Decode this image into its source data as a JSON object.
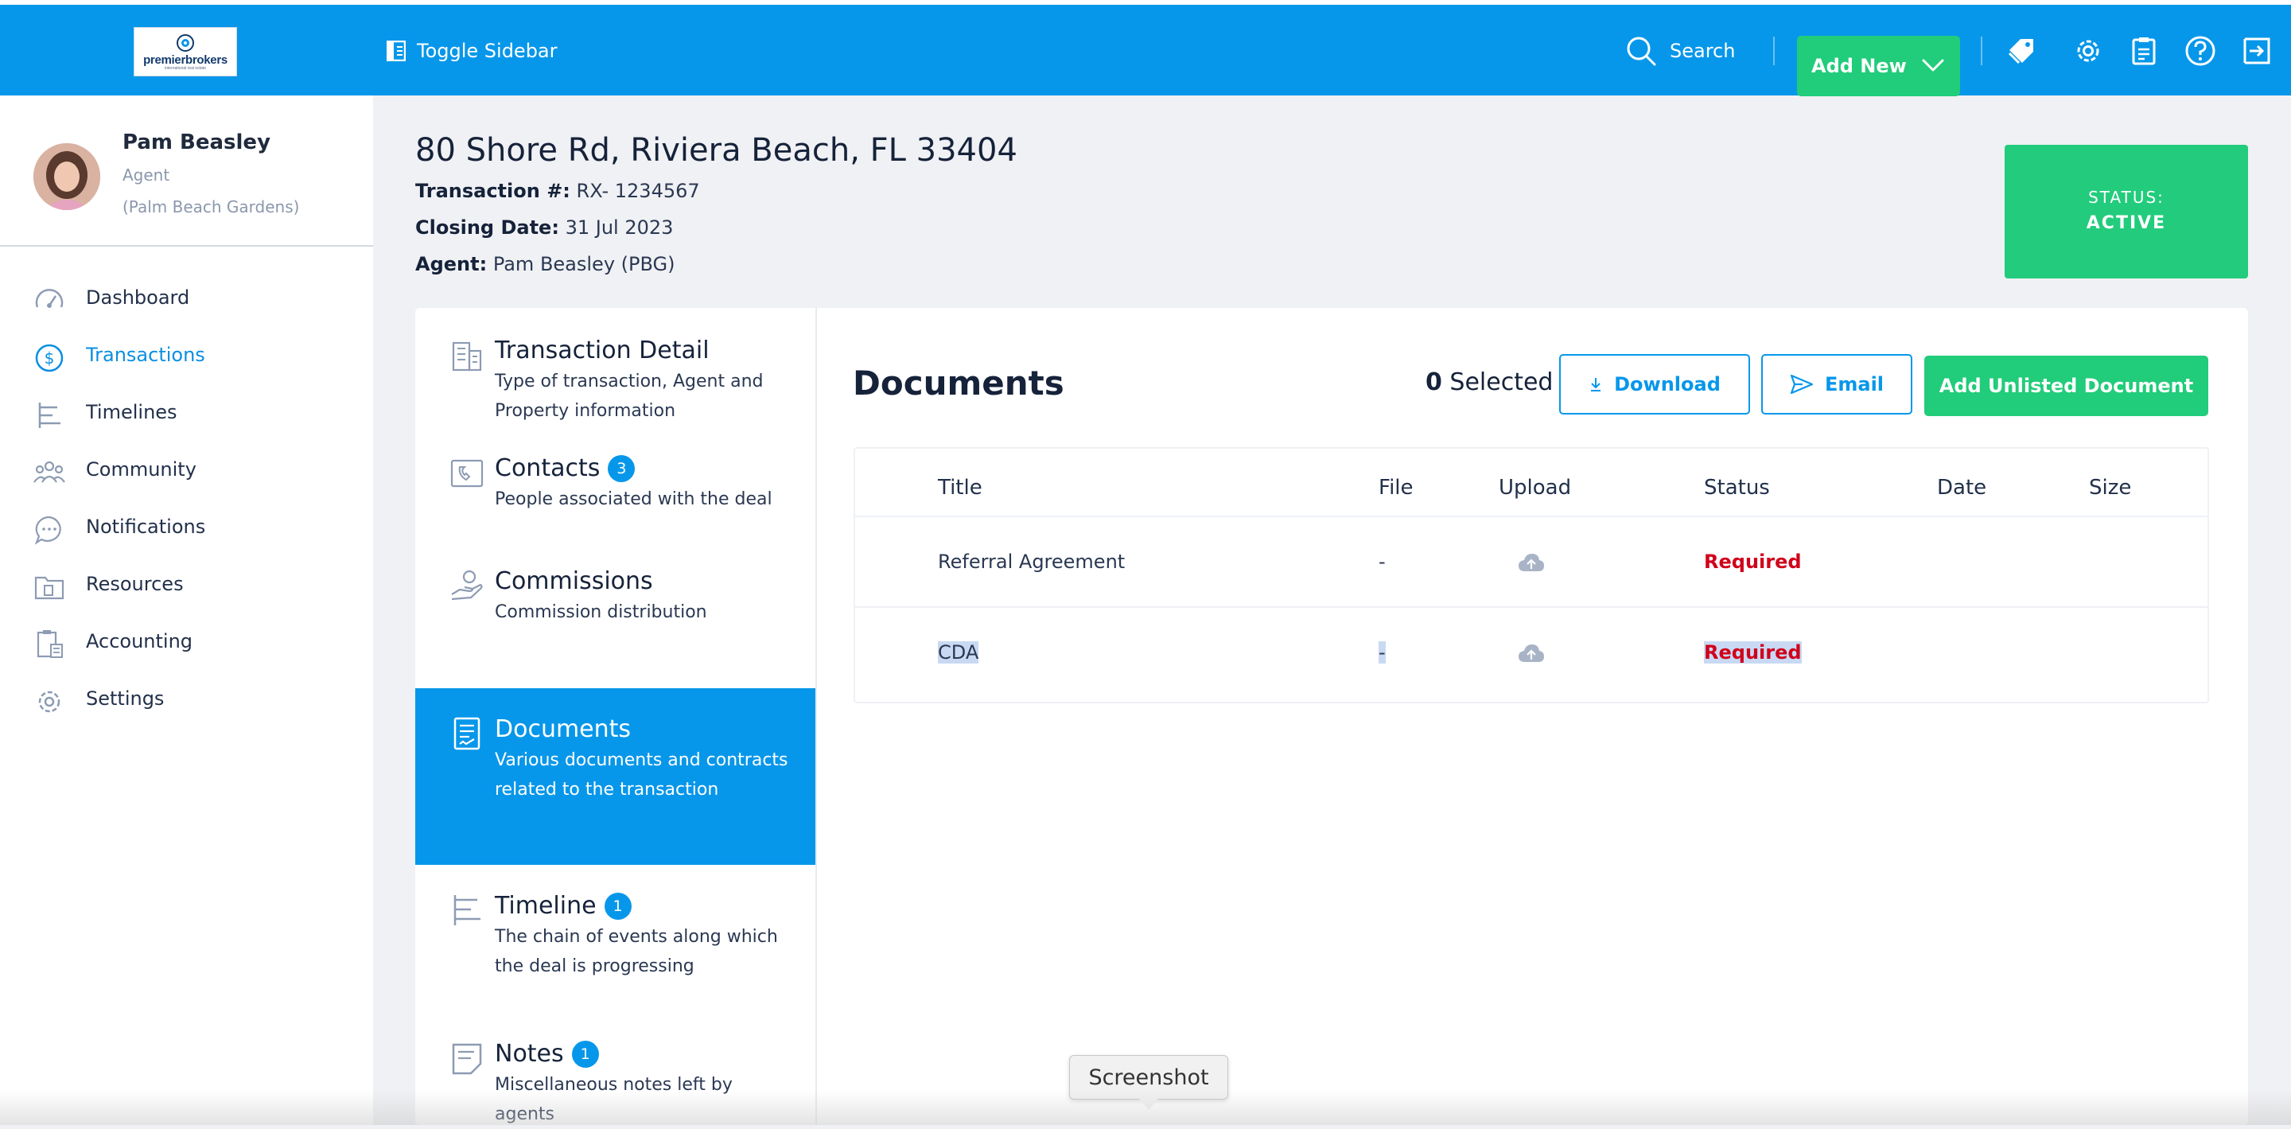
{
  "header": {
    "logo_text": "premierbrokers",
    "logo_subtext": "international real estate",
    "toggle_sidebar_label": "Toggle Sidebar",
    "search_label": "Search",
    "add_new_label": "Add New",
    "icons": [
      "tag-icon",
      "gear-icon",
      "clipboard-icon",
      "help-icon",
      "logout-icon"
    ]
  },
  "user": {
    "name": "Pam Beasley",
    "role": "Agent",
    "office": "(Palm Beach Gardens)"
  },
  "sidebar": {
    "items": [
      {
        "label": "Dashboard",
        "icon": "dashboard-gauge-icon",
        "active": false
      },
      {
        "label": "Transactions",
        "icon": "dollar-circle-icon",
        "active": true
      },
      {
        "label": "Timelines",
        "icon": "timeline-icon",
        "active": false
      },
      {
        "label": "Community",
        "icon": "community-people-icon",
        "active": false
      },
      {
        "label": "Notifications",
        "icon": "chat-bubble-icon",
        "active": false
      },
      {
        "label": "Resources",
        "icon": "folder-icon",
        "active": false
      },
      {
        "label": "Accounting",
        "icon": "accounting-icon",
        "active": false
      },
      {
        "label": "Settings",
        "icon": "gear-icon",
        "active": false
      }
    ]
  },
  "transaction": {
    "address": "80 Shore Rd, Riviera Beach, FL 33404",
    "number_label": "Transaction #:",
    "number_value": "RX- 1234567",
    "closing_label": "Closing Date:",
    "closing_value": "31 Jul 2023",
    "agent_label": "Agent:",
    "agent_value": "Pam Beasley (PBG)",
    "status_label": "STATUS:",
    "status_value": "ACTIVE",
    "status_color": "#22cc7c"
  },
  "tabs": [
    {
      "title": "Transaction Detail",
      "badge": "",
      "desc": "Type of transaction, Agent and Property information",
      "icon": "building-icon"
    },
    {
      "title": "Contacts",
      "badge": "3",
      "desc": "People associated with the deal",
      "icon": "contacts-phone-icon"
    },
    {
      "title": "Commissions",
      "badge": "",
      "desc": "Commission distribution",
      "icon": "hand-coin-icon"
    },
    {
      "title": "Documents",
      "badge": "",
      "desc": "Various documents and contracts related to the transaction",
      "icon": "document-icon"
    },
    {
      "title": "Timeline",
      "badge": "1",
      "desc": "The chain of events along which the deal is progressing",
      "icon": "timeline-icon"
    },
    {
      "title": "Notes",
      "badge": "1",
      "desc": "Miscellaneous notes left by agents",
      "icon": "note-icon"
    }
  ],
  "documents": {
    "title": "Documents",
    "selected_count": "0",
    "selected_label": "Selected",
    "download_label": "Download",
    "email_label": "Email",
    "add_unlisted_label": "Add Unlisted Document",
    "columns": [
      "Title",
      "File",
      "Upload",
      "Status",
      "Date",
      "Size"
    ],
    "rows": [
      {
        "title": "Referral Agreement",
        "file": "-",
        "status": "Required",
        "date": "",
        "size": ""
      },
      {
        "title": "CDA",
        "file": "-",
        "status": "Required",
        "date": "",
        "size": ""
      }
    ],
    "required_color": "#d0021b"
  },
  "tooltip": {
    "text": "Screenshot"
  },
  "colors": {
    "brand_blue": "#0797ea",
    "accent_green": "#21cc7a"
  }
}
